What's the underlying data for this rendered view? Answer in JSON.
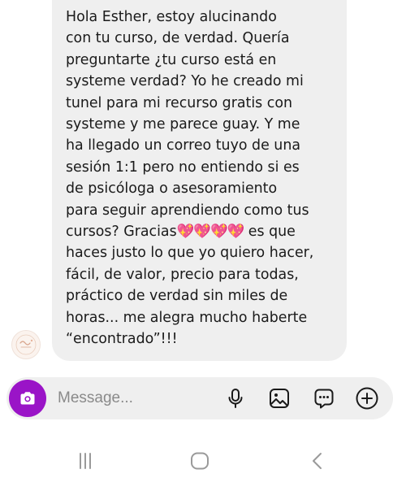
{
  "thread": {
    "incoming_message": {
      "sender_avatar_icon": "avatar-logo-icon",
      "text_before_emoji": "Hola Esther, estoy alucinando\ncon tu curso, de verdad. Quería\npreguntarte ¿tu curso está en\nsysteme verdad? Yo he creado mi\ntunel para mi recurso gratis con\nsysteme y me parece guay. Y me\nha llegado un correo tuyo de una\nsesión 1:1 pero no entiendo si es\nde psicóloga o asesoramiento\npara seguir aprendiendo como tus\ncursos? Gracias",
      "emoji": "💖💖💖💖",
      "text_after_emoji": " es que\nhaces justo lo que yo quiero hacer,\nfácil, de valor, precio para todas,\npráctico de verdad sin miles de\nhoras... me alegra mucho haberte\n“encontrado”!!!"
    }
  },
  "composer": {
    "camera_icon": "camera-icon",
    "placeholder": "Message...",
    "value": "",
    "actions": [
      {
        "name": "microphone-icon"
      },
      {
        "name": "gallery-icon"
      },
      {
        "name": "sticker-chat-icon"
      },
      {
        "name": "add-icon"
      }
    ]
  },
  "navigation_bar": {
    "buttons": [
      {
        "name": "recent-apps-icon"
      },
      {
        "name": "home-icon"
      },
      {
        "name": "back-icon"
      }
    ]
  },
  "colors": {
    "bubble_background": "#efefef",
    "camera_button": "#9a14c7",
    "heart_emoji": "#f5427a",
    "text": "#1a1a1a",
    "placeholder": "#8a8a8a",
    "nav_icons": "#9a9a9a"
  }
}
